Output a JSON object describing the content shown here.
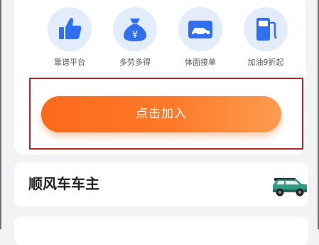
{
  "features": [
    {
      "label": "靠谱平台",
      "icon": "thumbs-up-icon"
    },
    {
      "label": "多劳多得",
      "icon": "money-bag-icon"
    },
    {
      "label": "体面接单",
      "icon": "car-card-icon"
    },
    {
      "label": "加油9折起",
      "icon": "fuel-pump-icon"
    }
  ],
  "join_button": {
    "label": "点击加入"
  },
  "owner_card": {
    "title": "顺风车车主",
    "icon": "suv-car-icon"
  },
  "colors": {
    "accent": "#ff7a28",
    "icon_blue": "#2f6ff0",
    "icon_bg": "#e3ecfb",
    "highlight": "#b2262b"
  }
}
